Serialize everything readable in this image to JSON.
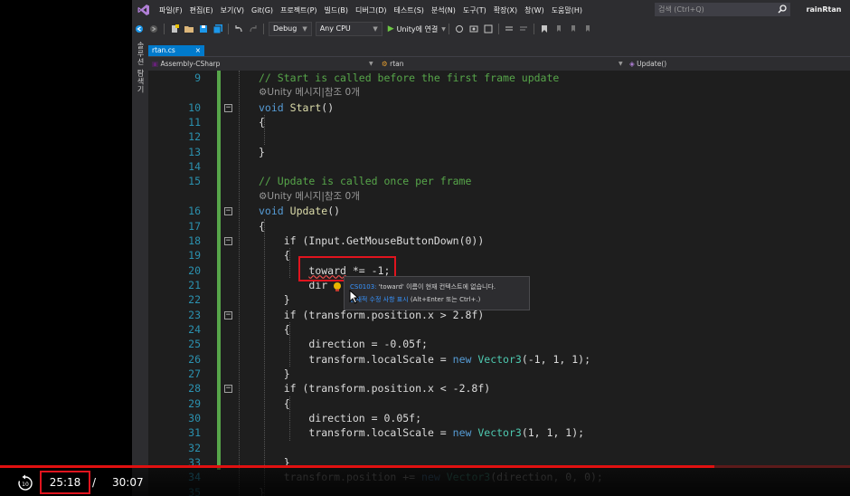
{
  "menubar": {
    "items": [
      "파일(F)",
      "편집(E)",
      "보기(V)",
      "Git(G)",
      "프로젝트(P)",
      "빌드(B)",
      "디버그(D)",
      "테스트(S)",
      "분석(N)",
      "도구(T)",
      "확장(X)",
      "창(W)",
      "도움말(H)"
    ],
    "search_placeholder": "검색 (Ctrl+Q)",
    "user": "rainRtan"
  },
  "toolbar": {
    "config": "Debug",
    "platform": "Any CPU",
    "run_label": "Unity에 연결"
  },
  "side_panel": {
    "label": "솔루션 탐색기"
  },
  "editor_tab": {
    "file": "rtan.cs",
    "close": "×"
  },
  "navbar": {
    "project": "Assembly-CSharp",
    "class": "rtan",
    "member": "Update()"
  },
  "code": {
    "lines": [
      {
        "n": "9",
        "t": "comment",
        "text": "// Start is called before the first frame update"
      },
      {
        "n": "",
        "t": "ref",
        "text": "Unity 메시지|참조 0개"
      },
      {
        "n": "10",
        "t": "decl",
        "kw": "void",
        "name": "Start",
        "rest": "()"
      },
      {
        "n": "11",
        "t": "plain",
        "text": "{"
      },
      {
        "n": "12",
        "t": "plain",
        "text": ""
      },
      {
        "n": "13",
        "t": "plain",
        "text": "}"
      },
      {
        "n": "14",
        "t": "plain",
        "text": ""
      },
      {
        "n": "15",
        "t": "comment",
        "text": "// Update is called once per frame"
      },
      {
        "n": "",
        "t": "ref",
        "text": "Unity 메시지|참조 0개"
      },
      {
        "n": "16",
        "t": "decl",
        "kw": "void",
        "name": "Update",
        "rest": "()"
      },
      {
        "n": "17",
        "t": "plain",
        "text": "{"
      },
      {
        "n": "18",
        "t": "if_input",
        "text": "if (Input.GetMouseButtonDown(0))"
      },
      {
        "n": "19",
        "t": "plain",
        "text": "{"
      },
      {
        "n": "20",
        "t": "err",
        "text": "toward *= -1;"
      },
      {
        "n": "21",
        "t": "plain",
        "text": "dir"
      },
      {
        "n": "22",
        "t": "plain",
        "text": "}"
      },
      {
        "n": "23",
        "t": "plain",
        "text": "if (transform.position.x > 2.8f)"
      },
      {
        "n": "24",
        "t": "plain",
        "text": "{"
      },
      {
        "n": "25",
        "t": "plain",
        "text": "direction = -0.05f;"
      },
      {
        "n": "26",
        "t": "scale",
        "pre": "transform.localScale = ",
        "kw": "new",
        "type": "Vector3",
        "args": "(-1, 1, 1);"
      },
      {
        "n": "27",
        "t": "plain",
        "text": "}"
      },
      {
        "n": "28",
        "t": "plain",
        "text": "if (transform.position.x < -2.8f)"
      },
      {
        "n": "29",
        "t": "plain",
        "text": "{"
      },
      {
        "n": "30",
        "t": "plain",
        "text": "direction = 0.05f;"
      },
      {
        "n": "31",
        "t": "scale",
        "pre": "transform.localScale = ",
        "kw": "new",
        "type": "Vector3",
        "args": "(1, 1, 1);"
      },
      {
        "n": "32",
        "t": "plain",
        "text": ""
      },
      {
        "n": "33",
        "t": "plain",
        "text": "}"
      },
      {
        "n": "34",
        "t": "scale",
        "pre": "transform.position += ",
        "kw": "new",
        "type": "Vector3",
        "args": "(direction, 0, 0);"
      },
      {
        "n": "35",
        "t": "plain",
        "text": "}"
      }
    ]
  },
  "tooltip": {
    "code": "CS0103:",
    "message": "'toward' 이름이 현재 컨텍스트에 없습니다.",
    "link": "잠재적 수정 사항 표시",
    "shortcut": "(Alt+Enter 또는 Ctrl+.)"
  },
  "player": {
    "current_time": "25:18",
    "separator": "/",
    "total_time": "30:07",
    "progress_fraction": 0.84,
    "replay_label": "10"
  },
  "colors": {
    "accent": "#007acc",
    "highlight": "#e0141e",
    "progress": "#e01010"
  }
}
